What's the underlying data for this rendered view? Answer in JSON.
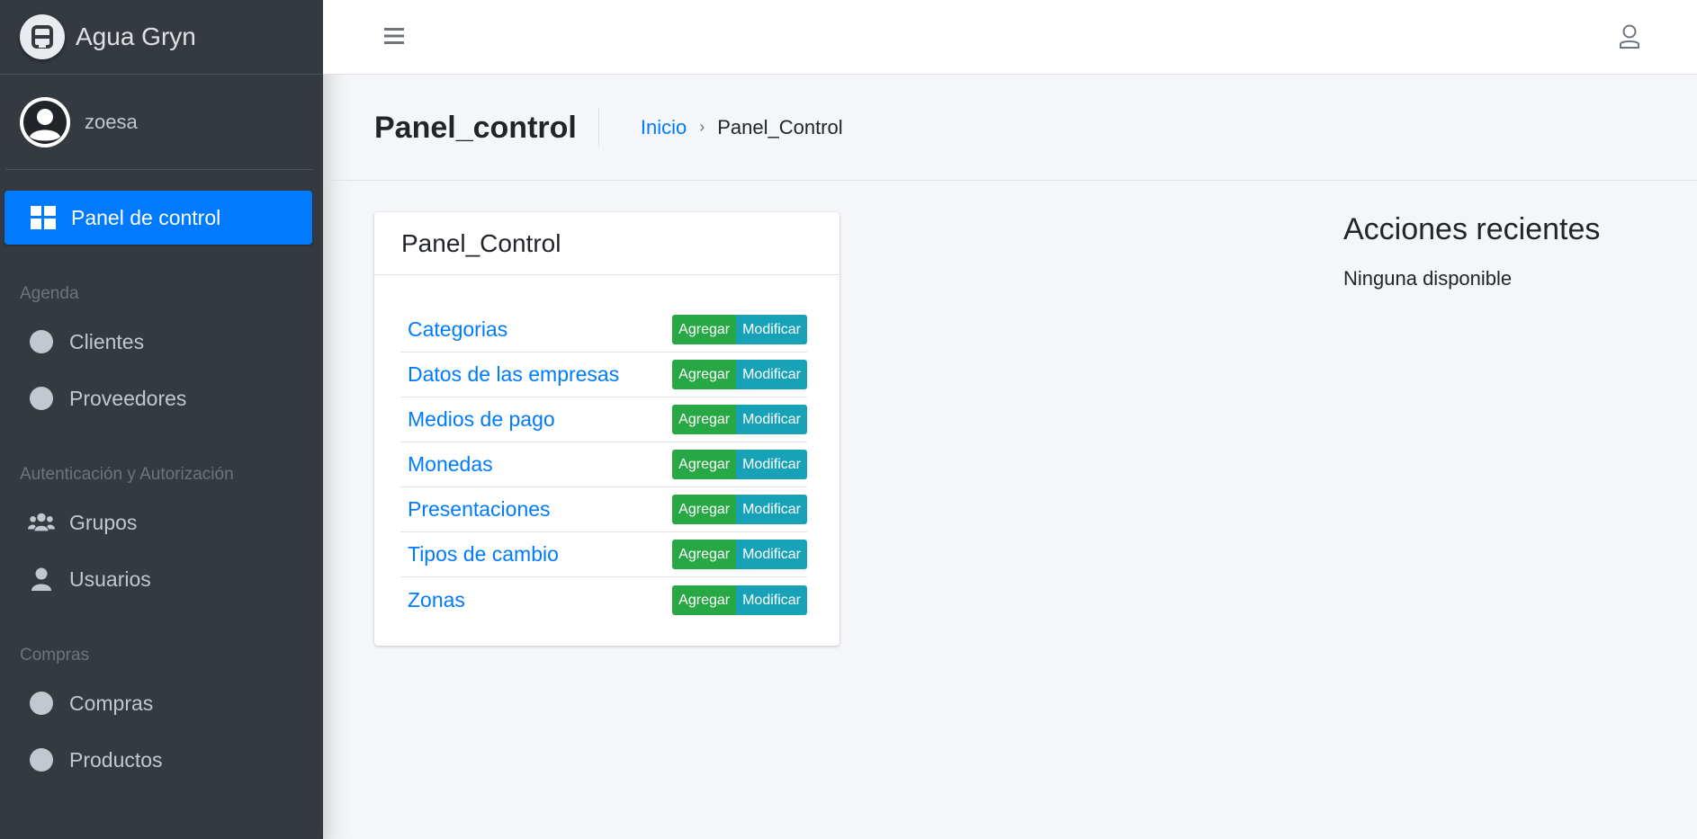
{
  "brand": {
    "name": "Agua Gryn"
  },
  "user": {
    "name": "zoesa"
  },
  "sidebar": {
    "active_item": {
      "label": "Panel de control",
      "icon": "dashboard-icon"
    },
    "sections": [
      {
        "header": "Agenda",
        "items": [
          {
            "label": "Clientes",
            "icon": "circle-icon"
          },
          {
            "label": "Proveedores",
            "icon": "circle-icon"
          }
        ]
      },
      {
        "header": "Autenticación y Autorización",
        "items": [
          {
            "label": "Grupos",
            "icon": "users-icon"
          },
          {
            "label": "Usuarios",
            "icon": "user-icon"
          }
        ]
      },
      {
        "header": "Compras",
        "items": [
          {
            "label": "Compras",
            "icon": "circle-icon"
          },
          {
            "label": "Productos",
            "icon": "circle-icon"
          }
        ]
      }
    ]
  },
  "header": {
    "title": "Panel_control",
    "breadcrumb": {
      "home": "Inicio",
      "separator": "›",
      "current": "Panel_Control"
    }
  },
  "card": {
    "title": "Panel_Control",
    "add_label": "Agregar",
    "modify_label": "Modificar",
    "rows": [
      {
        "label": "Categorias"
      },
      {
        "label": "Datos de las empresas"
      },
      {
        "label": "Medios de pago"
      },
      {
        "label": "Monedas"
      },
      {
        "label": "Presentaciones"
      },
      {
        "label": "Tipos de cambio"
      },
      {
        "label": "Zonas"
      }
    ]
  },
  "recent": {
    "title": "Acciones recientes",
    "empty": "Ninguna disponible"
  },
  "colors": {
    "sidebar": "#343a40",
    "primary": "#007bff",
    "success": "#28a745",
    "info": "#17a2b8"
  }
}
